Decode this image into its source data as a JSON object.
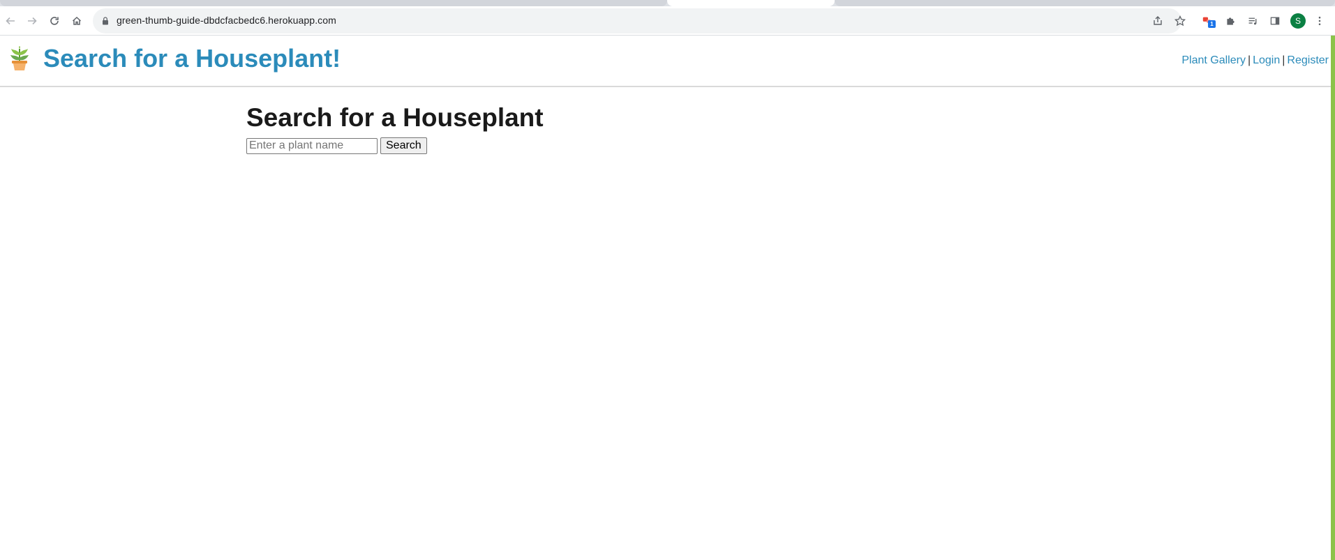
{
  "browser": {
    "url": "green-thumb-guide-dbdcfacbedc6.herokuapp.com",
    "profile_initial": "S",
    "extension_badge": "1"
  },
  "header": {
    "logo_icon": "potted-plant-icon",
    "title": "Search for a Houseplant!",
    "nav": {
      "gallery": "Plant Gallery",
      "separator": "|",
      "login": "Login",
      "register": "Register"
    }
  },
  "main": {
    "heading": "Search for a Houseplant",
    "search_placeholder": "Enter a plant name",
    "search_button": "Search"
  },
  "colors": {
    "title_link": "#2b8bba",
    "accent_bar": "#8bc34a",
    "avatar": "#0b8043"
  }
}
